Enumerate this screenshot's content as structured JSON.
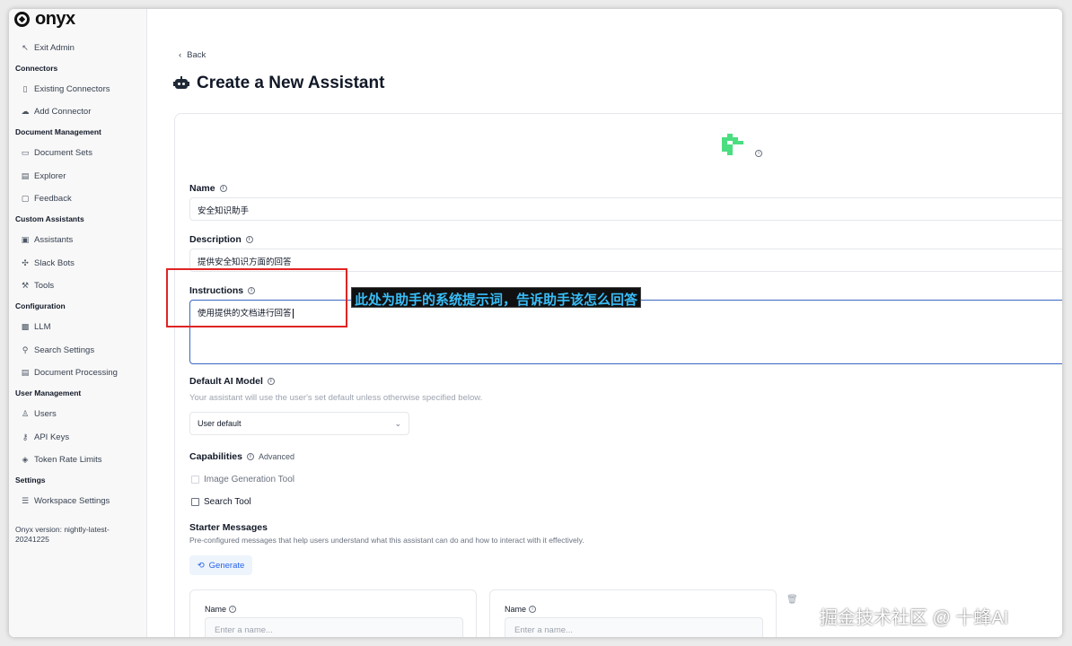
{
  "brand": "onyx",
  "sidebar": {
    "exit": "Exit Admin",
    "sections": [
      {
        "title": "Connectors"
      },
      {
        "title": "Document Management"
      },
      {
        "title": "Custom Assistants"
      },
      {
        "title": "Configuration"
      },
      {
        "title": "User Management"
      },
      {
        "title": "Settings"
      }
    ],
    "items": [
      {
        "label": "Existing Connectors"
      },
      {
        "label": "Add Connector"
      },
      {
        "label": "Document Sets"
      },
      {
        "label": "Explorer"
      },
      {
        "label": "Feedback"
      },
      {
        "label": "Assistants"
      },
      {
        "label": "Slack Bots"
      },
      {
        "label": "Tools"
      },
      {
        "label": "LLM"
      },
      {
        "label": "Search Settings"
      },
      {
        "label": "Document Processing"
      },
      {
        "label": "Users"
      },
      {
        "label": "API Keys"
      },
      {
        "label": "Token Rate Limits"
      },
      {
        "label": "Workspace Settings"
      }
    ],
    "version": "Onyx version: nightly-latest-20241225"
  },
  "main": {
    "back": "Back",
    "title": "Create a New Assistant",
    "name_label": "Name",
    "name_value": "安全知识助手",
    "description_label": "Description",
    "description_value": "提供安全知识方面的回答",
    "instructions_label": "Instructions",
    "instructions_value": "使用提供的文档进行回答",
    "model_label": "Default AI Model",
    "model_hint": "Your assistant will use the user's set default unless otherwise specified below.",
    "model_value": "User default",
    "capabilities_label": "Capabilities",
    "capabilities_advanced": "Advanced",
    "tool_image": "Image Generation Tool",
    "tool_search": "Search Tool",
    "starter_label": "Starter Messages",
    "starter_hint": "Pre-configured messages that help users understand what this assistant can do and how to interact with it effectively.",
    "generate": "Generate",
    "sm_name_label": "Name",
    "sm_placeholder": "Enter a name..."
  },
  "annotation": "此处为助手的系统提示词，告诉助手该怎么回答",
  "watermark": "掘金技术社区 @ 十蜂AI",
  "colors": {
    "accent": "#2563eb",
    "annotation_box": "#e02424",
    "annotation_text": "#38bdf8",
    "avatar": "#4ade80"
  }
}
